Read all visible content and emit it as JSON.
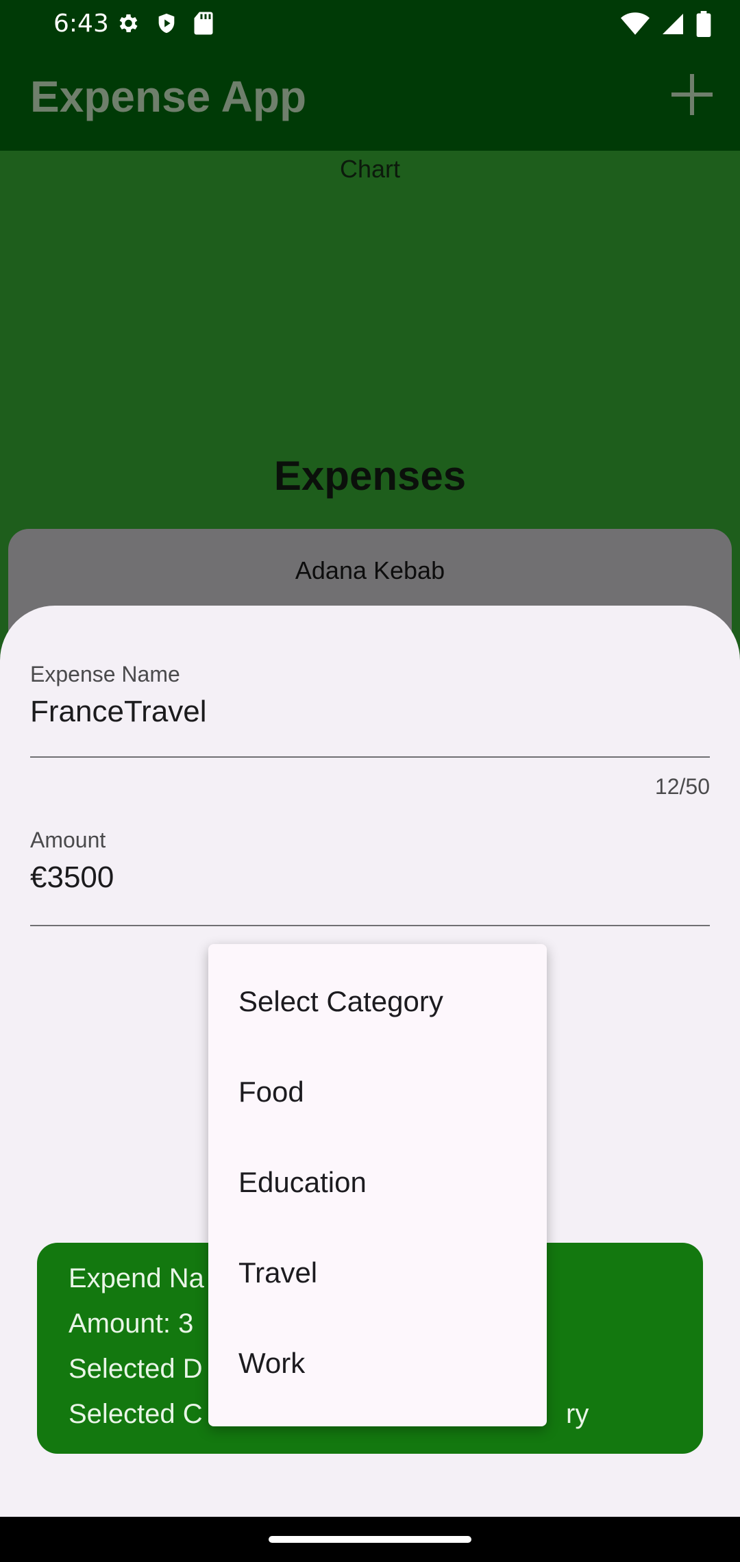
{
  "status_bar": {
    "time": "6:43",
    "left_icons": [
      "gear-icon",
      "shield-icon",
      "sd-card-icon"
    ],
    "right_icons": [
      "wifi-icon",
      "signal-icon",
      "battery-icon"
    ]
  },
  "app_bar": {
    "title": "Expense App",
    "add_icon": "plus-icon"
  },
  "background": {
    "chart_label": "Chart",
    "expenses_heading": "Expenses",
    "first_item_title": "Adana Kebab"
  },
  "form": {
    "expense_name": {
      "label": "Expense Name",
      "value": "FranceTravel",
      "counter": "12/50"
    },
    "amount": {
      "label": "Amount",
      "prefix": "€",
      "value": "3500"
    }
  },
  "summary": {
    "line1": "Expend Na",
    "line2": "Amount: 3",
    "line3": "Selected D",
    "line4": "Selected C",
    "line4_tail": "ry"
  },
  "dropdown": {
    "items": [
      "Select Category",
      "Food",
      "Education",
      "Travel",
      "Work"
    ]
  },
  "colors": {
    "app_bar": "#003a06",
    "content_green": "#1e5e1c",
    "summary_green": "#13780f",
    "sheet": "#f4f0f6",
    "menu": "#fdf7fc"
  }
}
